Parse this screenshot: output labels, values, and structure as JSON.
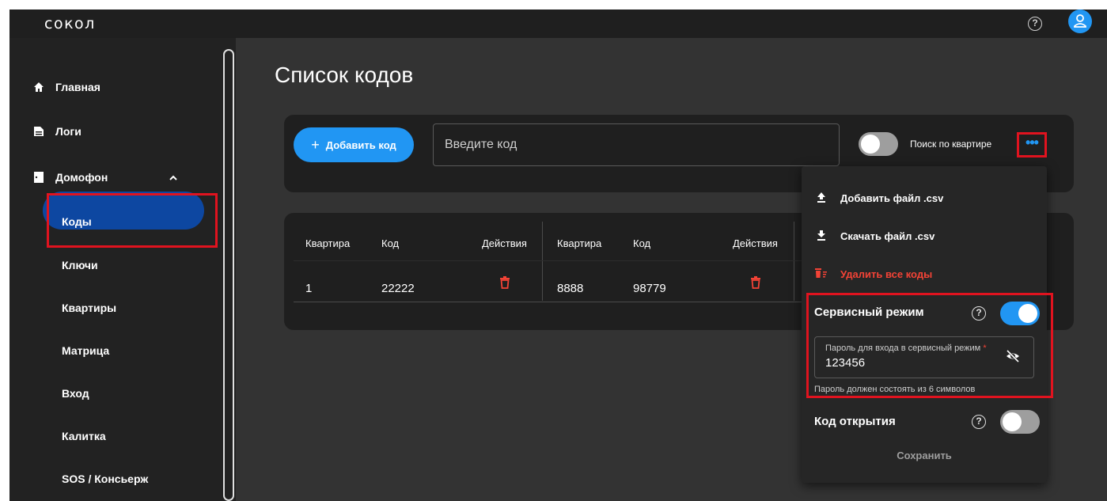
{
  "app": {
    "logo": "сокол"
  },
  "topbar": {
    "help_icon": "help-circle-icon",
    "user_icon": "user-icon",
    "accent": "#2196f3"
  },
  "sidebar": {
    "items": [
      {
        "label": "Главная",
        "icon": "home-icon"
      },
      {
        "label": "Логи",
        "icon": "document-icon"
      },
      {
        "label": "Домофон",
        "icon": "door-icon",
        "expanded": true
      }
    ],
    "subitems": [
      {
        "label": "Коды",
        "active": true
      },
      {
        "label": "Ключи"
      },
      {
        "label": "Квартиры"
      },
      {
        "label": "Матрица"
      },
      {
        "label": "Вход"
      },
      {
        "label": "Калитка"
      },
      {
        "label": "SOS / Консьерж"
      }
    ],
    "active_color": "#0d47a1"
  },
  "main": {
    "title": "Список кодов",
    "add_button": "Добавить код",
    "add_button_icon": "+",
    "code_input_placeholder": "Введите код",
    "search_by_apartment_label": "Поиск по квартире",
    "search_by_apartment_on": false,
    "more_icon": "•••"
  },
  "table": {
    "headers": [
      "Квартира",
      "Код",
      "Действия",
      "Квартира",
      "Код",
      "Действия"
    ],
    "rows": [
      {
        "apartment_1": "1",
        "code_1": "22222",
        "apartment_2": "8888",
        "code_2": "98779"
      }
    ]
  },
  "dropdown": {
    "items": [
      {
        "label": "Добавить файл .csv",
        "icon": "upload-icon"
      },
      {
        "label": "Скачать файл .csv",
        "icon": "download-icon"
      },
      {
        "label": "Удалить все коды",
        "icon": "delete-sweep-icon",
        "danger": true
      }
    ],
    "service_mode": {
      "label": "Сервисный режим",
      "enabled": true
    },
    "password": {
      "label": "Пароль для входа в сервисный режим",
      "required_mark": "*",
      "value": "123456",
      "hint": "Пароль должен состоять из 6 символов"
    },
    "open_code": {
      "label": "Код открытия",
      "enabled": false
    },
    "save_button": "Сохранить"
  },
  "colors": {
    "danger": "#f44336",
    "highlight": "#e0131f"
  }
}
